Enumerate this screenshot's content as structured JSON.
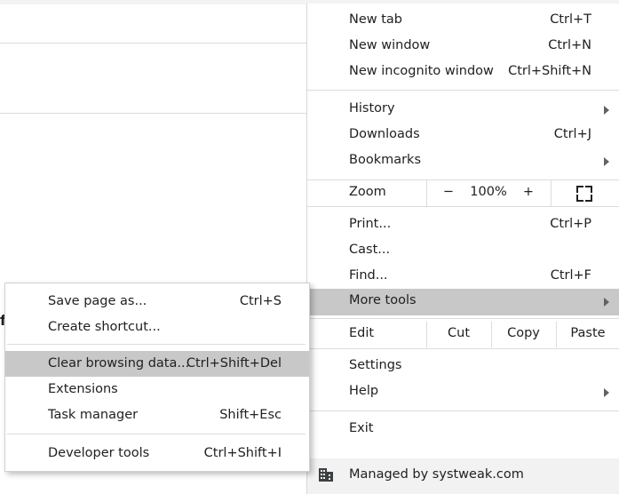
{
  "main_menu": {
    "new_tab": {
      "label": "New tab",
      "shortcut": "Ctrl+T"
    },
    "new_window": {
      "label": "New window",
      "shortcut": "Ctrl+N"
    },
    "new_incognito": {
      "label": "New incognito window",
      "shortcut": "Ctrl+Shift+N"
    },
    "history": {
      "label": "History"
    },
    "downloads": {
      "label": "Downloads",
      "shortcut": "Ctrl+J"
    },
    "bookmarks": {
      "label": "Bookmarks"
    },
    "zoom": {
      "label": "Zoom",
      "minus": "−",
      "level": "100%",
      "plus": "+"
    },
    "print": {
      "label": "Print...",
      "shortcut": "Ctrl+P"
    },
    "cast": {
      "label": "Cast..."
    },
    "find": {
      "label": "Find...",
      "shortcut": "Ctrl+F"
    },
    "more_tools": {
      "label": "More tools"
    },
    "edit": {
      "label": "Edit",
      "cut": "Cut",
      "copy": "Copy",
      "paste": "Paste"
    },
    "settings": {
      "label": "Settings"
    },
    "help": {
      "label": "Help"
    },
    "exit": {
      "label": "Exit"
    },
    "managed": {
      "label": "Managed by systweak.com"
    }
  },
  "sub_menu": {
    "save_page": {
      "label": "Save page as...",
      "shortcut": "Ctrl+S"
    },
    "create_shortcut": {
      "label": "Create shortcut..."
    },
    "clear_data": {
      "label": "Clear browsing data...",
      "shortcut": "Ctrl+Shift+Del"
    },
    "extensions": {
      "label": "Extensions"
    },
    "task_manager": {
      "label": "Task manager",
      "shortcut": "Shift+Esc"
    },
    "dev_tools": {
      "label": "Developer tools",
      "shortcut": "Ctrl+Shift+I"
    }
  },
  "page": {
    "edge_glyph": "f"
  },
  "colors": {
    "highlight": "#c8c8c8",
    "separator": "#dcdcdc",
    "text": "#202124"
  },
  "icons": {
    "fullscreen": "fullscreen-icon",
    "submenu": "chevron-right-icon",
    "managed": "building-icon"
  }
}
